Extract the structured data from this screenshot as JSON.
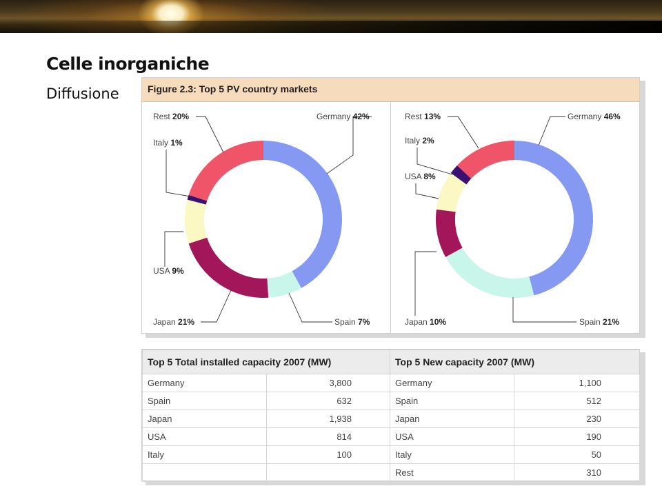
{
  "slide": {
    "title": "Celle inorganiche",
    "subtitle": "Diffusione"
  },
  "figure": {
    "title": "Figure 2.3: Top 5 PV country markets"
  },
  "chart_data": [
    {
      "type": "pie",
      "donut": true,
      "slices": [
        {
          "label": "Germany",
          "value": 42,
          "pct_text": "42%",
          "color": "#8599f2"
        },
        {
          "label": "Spain",
          "value": 7,
          "pct_text": "7%",
          "color": "#c9f6ea"
        },
        {
          "label": "Japan",
          "value": 21,
          "pct_text": "21%",
          "color": "#a3175a"
        },
        {
          "label": "USA",
          "value": 9,
          "pct_text": "9%",
          "color": "#fbf8c3"
        },
        {
          "label": "Italy",
          "value": 1,
          "pct_text": "1%",
          "color": "#3a1070"
        },
        {
          "label": "Rest",
          "value": 20,
          "pct_text": "20%",
          "color": "#f05468"
        }
      ]
    },
    {
      "type": "pie",
      "donut": true,
      "slices": [
        {
          "label": "Germany",
          "value": 46,
          "pct_text": "46%",
          "color": "#8599f2"
        },
        {
          "label": "Spain",
          "value": 21,
          "pct_text": "21%",
          "color": "#c9f6ea"
        },
        {
          "label": "Japan",
          "value": 10,
          "pct_text": "10%",
          "color": "#a3175a"
        },
        {
          "label": "USA",
          "value": 8,
          "pct_text": "8%",
          "color": "#fbf8c3"
        },
        {
          "label": "Italy",
          "value": 2,
          "pct_text": "2%",
          "color": "#3a1070"
        },
        {
          "label": "Rest",
          "value": 13,
          "pct_text": "13%",
          "color": "#f05468"
        }
      ]
    }
  ],
  "table": {
    "headers": [
      "Top 5 Total installed capacity 2007 (MW)",
      "Top 5 New capacity 2007 (MW)"
    ],
    "rows": [
      [
        "Germany",
        "3,800",
        "Germany",
        "1,100"
      ],
      [
        "Spain",
        "632",
        "Spain",
        "512"
      ],
      [
        "Japan",
        "1,938",
        "Japan",
        "230"
      ],
      [
        "USA",
        "814",
        "USA",
        "190"
      ],
      [
        "Italy",
        "100",
        "Italy",
        "50"
      ],
      [
        "",
        "",
        "Rest",
        "310"
      ]
    ]
  }
}
